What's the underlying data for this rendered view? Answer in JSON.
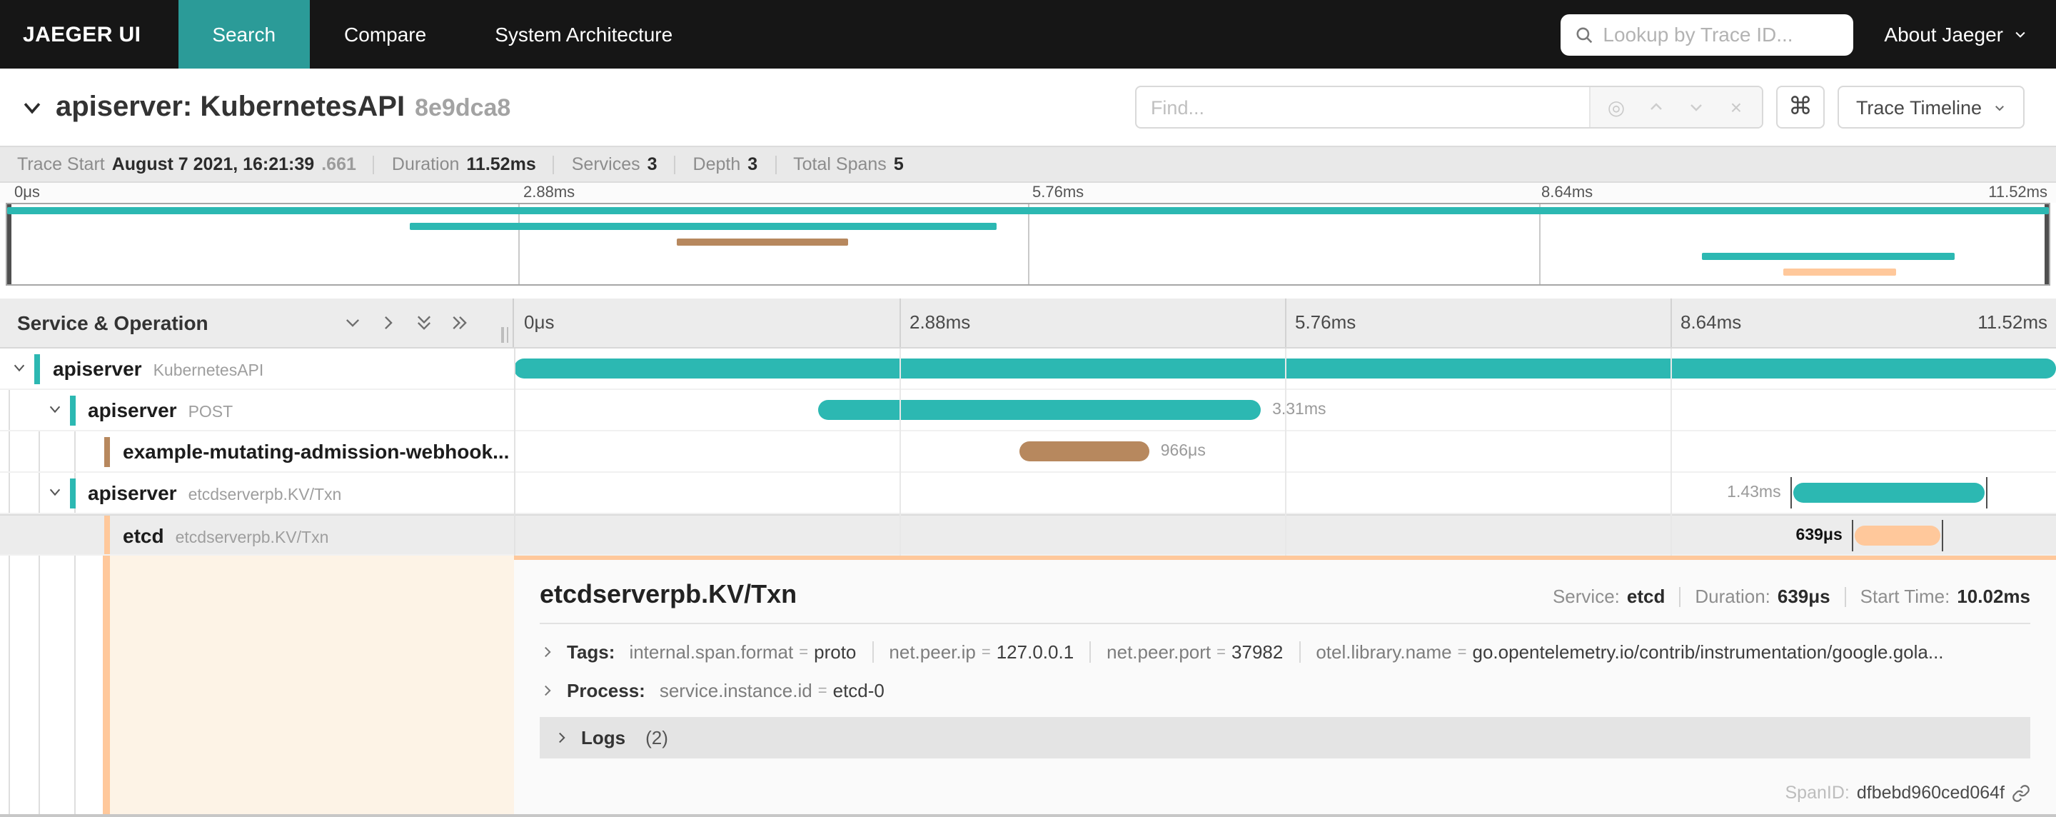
{
  "colors": {
    "teal": "#2CB8B2",
    "brown": "#B7885E",
    "orange": "#FFC89B",
    "nav_active": "#2B9B98",
    "selected_cream": "#FDF3E6"
  },
  "nav": {
    "brand": "JAEGER UI",
    "tabs": [
      {
        "label": "Search",
        "active": true
      },
      {
        "label": "Compare",
        "active": false
      },
      {
        "label": "System Architecture",
        "active": false
      }
    ],
    "lookup_placeholder": "Lookup by Trace ID...",
    "about_label": "About Jaeger"
  },
  "trace_header": {
    "title": "apiserver: KubernetesAPI",
    "trace_short_id": "8e9dca8",
    "find_placeholder": "Find...",
    "view_selector_label": "Trace Timeline",
    "cmd_symbol": "⌘",
    "find_buttons": {
      "target": "◎",
      "prev": "∧",
      "next": "∨",
      "clear": "×"
    }
  },
  "summary": {
    "trace_start_label": "Trace Start",
    "trace_start_value": "August 7 2021, 16:21:39",
    "trace_start_fraction": ".661",
    "duration_label": "Duration",
    "duration_value": "11.52ms",
    "services_label": "Services",
    "services_value": "3",
    "depth_label": "Depth",
    "depth_value": "3",
    "total_spans_label": "Total Spans",
    "total_spans_value": "5"
  },
  "timeline": {
    "column_header": "Service & Operation",
    "ticks": [
      "0μs",
      "2.88ms",
      "5.76ms",
      "8.64ms",
      "11.52ms"
    ]
  },
  "spans": [
    {
      "service": "apiserver",
      "operation": "KubernetesAPI",
      "color": "#2CB8B2",
      "depth": 0,
      "expandable": true,
      "start_pct": 0,
      "width_pct": 100,
      "duration_label": "",
      "label_side": "right",
      "selected": false,
      "end_ticks": false
    },
    {
      "service": "apiserver",
      "operation": "POST",
      "color": "#2CB8B2",
      "depth": 1,
      "expandable": true,
      "start_pct": 19.7,
      "width_pct": 28.73,
      "duration_label": "3.31ms",
      "label_side": "right",
      "selected": false,
      "end_ticks": false
    },
    {
      "service": "example-mutating-admission-webhook...",
      "operation": "",
      "color": "#B7885E",
      "depth": 2,
      "expandable": false,
      "start_pct": 32.8,
      "width_pct": 8.39,
      "duration_label": "966μs",
      "label_side": "right",
      "selected": false,
      "end_ticks": false
    },
    {
      "service": "apiserver",
      "operation": "etcdserverpb.KV/Txn",
      "color": "#2CB8B2",
      "depth": 1,
      "expandable": true,
      "start_pct": 82.99,
      "width_pct": 12.41,
      "duration_label": "1.43ms",
      "label_side": "left",
      "selected": false,
      "end_ticks": true
    },
    {
      "service": "etcd",
      "operation": "etcdserverpb.KV/Txn",
      "color": "#FFC89B",
      "depth": 2,
      "expandable": false,
      "start_pct": 86.98,
      "width_pct": 5.55,
      "duration_label": "639μs",
      "label_side": "left",
      "selected": true,
      "end_ticks": true
    }
  ],
  "detail": {
    "title": "etcdserverpb.KV/Txn",
    "service_label": "Service:",
    "service_value": "etcd",
    "duration_label": "Duration:",
    "duration_value": "639μs",
    "start_time_label": "Start Time:",
    "start_time_value": "10.02ms",
    "tags_label": "Tags:",
    "tags": [
      {
        "key": "internal.span.format",
        "value": "proto"
      },
      {
        "key": "net.peer.ip",
        "value": "127.0.0.1"
      },
      {
        "key": "net.peer.port",
        "value": "37982"
      },
      {
        "key": "otel.library.name",
        "value": "go.opentelemetry.io/contrib/instrumentation/google.gola..."
      }
    ],
    "process_label": "Process:",
    "process_tags": [
      {
        "key": "service.instance.id",
        "value": "etcd-0"
      }
    ],
    "logs_label": "Logs",
    "logs_count": "(2)",
    "span_id_label": "SpanID:",
    "span_id_value": "dfbebd960ced064f"
  }
}
